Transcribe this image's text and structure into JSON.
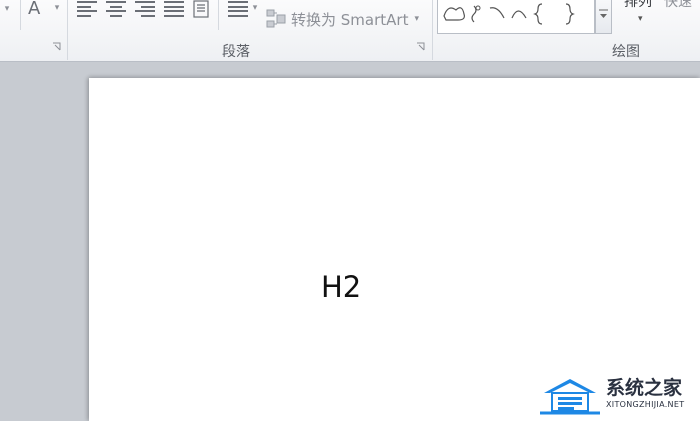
{
  "ribbon": {
    "font_color_button": "A",
    "convert_smartart_label": "转换为 SmartArt",
    "paragraph_group_label": "段落",
    "drawing_group_label": "绘图",
    "arrange_label": "排列",
    "quick_styles_label": "快速"
  },
  "document": {
    "heading_text": "H2"
  },
  "watermark": {
    "title": "系统之家",
    "subtitle": "XITONGZHIJIA.NET"
  },
  "colors": {
    "ribbon_bg": "#eef0f3",
    "workspace_bg": "#c7cbd1",
    "page_bg": "#ffffff",
    "watermark_blue": "#1e88e5"
  }
}
